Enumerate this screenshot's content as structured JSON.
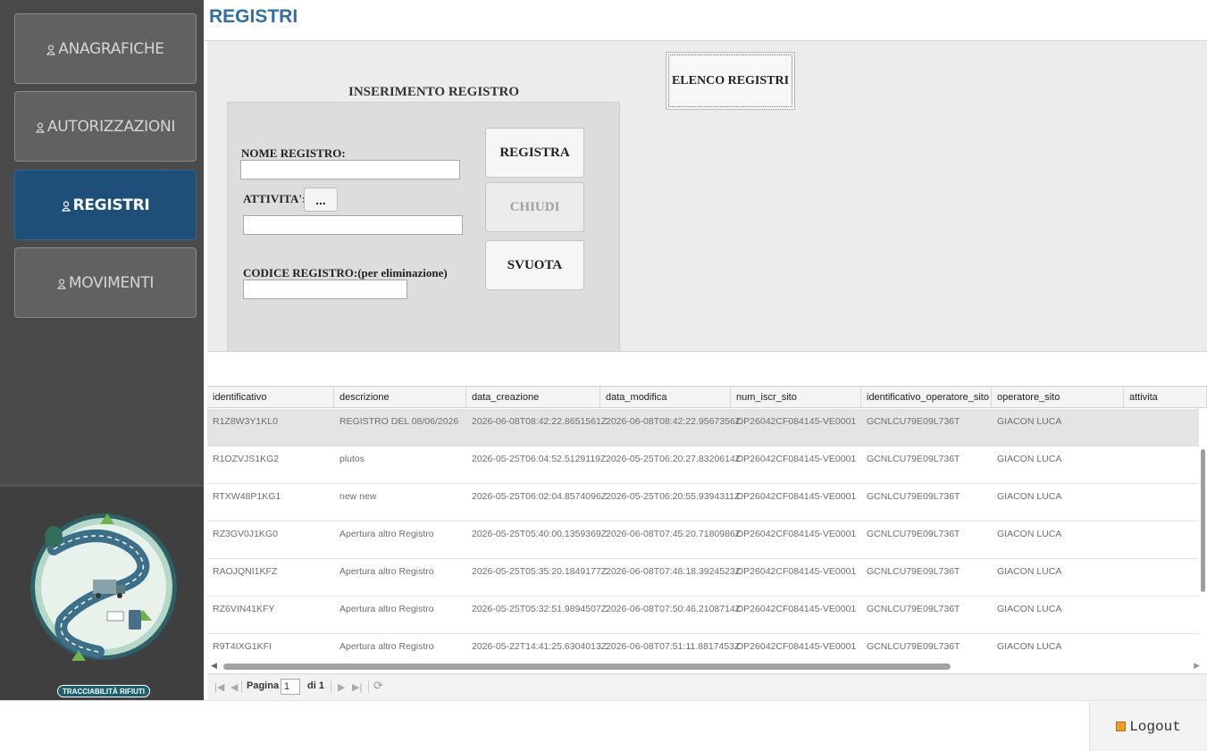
{
  "sidebar": {
    "items": [
      {
        "label": "ANAGRAFICHE",
        "icon": "user-icon"
      },
      {
        "label": "AUTORIZZAZIONI",
        "icon": "user-icon"
      },
      {
        "label": "REGISTRI",
        "icon": "user-icon",
        "active": true
      },
      {
        "label": "MOVIMENTI",
        "icon": "user-icon"
      }
    ],
    "logo_badge": "TRACCIABILITÀ RIFIUTI"
  },
  "header": {
    "title": "REGISTRI"
  },
  "form": {
    "title": "INSERIMENTO REGISTRO",
    "nome_label": "NOME REGISTRO:",
    "attivita_label": "ATTIVITA':",
    "dots_label": "...",
    "codice_label": "CODICE REGISTRO:(per eliminazione)",
    "registra_label": "REGISTRA",
    "chiudi_label": "CHIUDI",
    "svuota_label": "SVUOTA",
    "elenco_label": "ELENCO REGISTRI"
  },
  "grid": {
    "columns": [
      "identificativo",
      "descrizione",
      "data_creazione",
      "data_modifica",
      "num_iscr_sito",
      "identificativo_operatore_sito",
      "operatore_sito",
      "attivita"
    ],
    "rows": [
      [
        "R1Z8W3Y1KL0",
        "REGISTRO DEL 08/06/2026",
        "2026-06-08T08:42:22.8651561Z",
        "2026-06-08T08:42:22.9567356Z",
        "OP26042CF084145-VE0001",
        "GCNLCU79E09L736T",
        "GIACON LUCA",
        ""
      ],
      [
        "R1OZVJS1KG2",
        "plutos",
        "2026-05-25T06:04:52.5129119Z",
        "2026-05-25T06:20:27.8320614Z",
        "OP26042CF084145-VE0001",
        "GCNLCU79E09L736T",
        "GIACON LUCA",
        ""
      ],
      [
        "RTXW48P1KG1",
        "new new",
        "2026-05-25T06:02:04.8574096Z",
        "2026-05-25T06:20:55.9394311Z",
        "OP26042CF084145-VE0001",
        "GCNLCU79E09L736T",
        "GIACON LUCA",
        ""
      ],
      [
        "RZ3GV0J1KG0",
        "Apertura altro Registro",
        "2026-05-25T05:40:00.1359369Z",
        "2026-06-08T07:45:20.7180986Z",
        "OP26042CF084145-VE0001",
        "GCNLCU79E09L736T",
        "GIACON LUCA",
        ""
      ],
      [
        "RAOJQNI1KFZ",
        "Apertura altro Registro",
        "2026-05-25T05:35:20.1849177Z",
        "2026-06-08T07:48:18.3924523Z",
        "OP26042CF084145-VE0001",
        "GCNLCU79E09L736T",
        "GIACON LUCA",
        ""
      ],
      [
        "RZ6VIN41KFY",
        "Apertura altro Registro",
        "2026-05-25T05:32:51.9894507Z",
        "2026-06-08T07:50:46.2108714Z",
        "OP26042CF084145-VE0001",
        "GCNLCU79E09L736T",
        "GIACON LUCA",
        ""
      ],
      [
        "R9T4IXG1KFI",
        "Apertura altro Registro",
        "2026-05-22T14:41:25.6304013Z",
        "2026-06-08T07:51:11.8817453Z",
        "OP26042CF084145-VE0001",
        "GCNLCU79E09L736T",
        "GIACON LUCA",
        ""
      ]
    ]
  },
  "pager": {
    "page_label": "Pagina",
    "page_value": "1",
    "of_label": "di 1"
  },
  "footer": {
    "logout_label": "Logout"
  }
}
